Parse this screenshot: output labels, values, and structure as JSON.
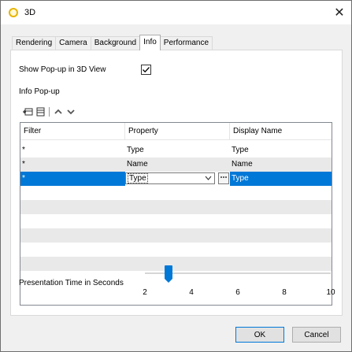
{
  "window": {
    "title": "3D",
    "close_label": "✕"
  },
  "tabs": [
    {
      "label": "Rendering",
      "active": false
    },
    {
      "label": "Camera",
      "active": false
    },
    {
      "label": "Background",
      "active": false
    },
    {
      "label": "Info",
      "active": true
    },
    {
      "label": "Performance",
      "active": false
    }
  ],
  "info": {
    "show_popup_label": "Show Pop-up in 3D View",
    "show_popup_checked": true,
    "info_popup_label": "Info Pop-up",
    "grid": {
      "headers": [
        "Filter",
        "Property",
        "Display Name"
      ],
      "rows": [
        {
          "filter": "*",
          "property": "Type",
          "display": "Type"
        },
        {
          "filter": "*",
          "property": "Name",
          "display": "Name"
        },
        {
          "filter": "*",
          "property": "Type",
          "display": "Type"
        }
      ]
    },
    "slider": {
      "label": "Presentation Time in Seconds",
      "value": 3,
      "min": 2,
      "max": 10,
      "ticks": [
        "2",
        "4",
        "6",
        "8",
        "10"
      ]
    }
  },
  "buttons": {
    "ok": "OK",
    "cancel": "Cancel"
  }
}
